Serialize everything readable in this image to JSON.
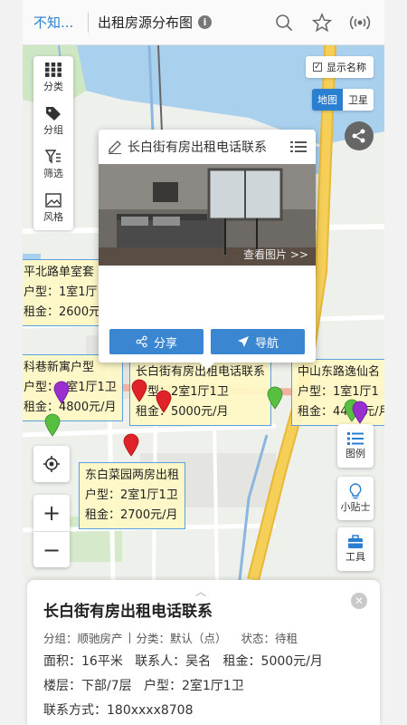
{
  "topbar": {
    "back": "不知...",
    "title": "出租房源分布图"
  },
  "map_controls": {
    "tools": [
      "分类",
      "分组",
      "筛选",
      "风格"
    ],
    "show_names": "显示名称",
    "map_types": [
      "地图",
      "卫星"
    ]
  },
  "popup": {
    "title": "长白街有房出租电话联系",
    "view_photos": "查看图片 >>",
    "share": "分享",
    "navigate": "导航"
  },
  "labels": [
    {
      "title": "平北路单室套",
      "type": "户型：1室1厅1卫",
      "rent": "租金：2600元/月"
    },
    {
      "title": "科巷新寓户型",
      "type": "户型：2室1厅1卫",
      "rent": "租金：4800元/月"
    },
    {
      "title": "长白街有房出租电话联系",
      "type": "户型：2室1厅1卫",
      "rent": "租金：5000元/月"
    },
    {
      "title": "中山东路逸仙名",
      "type": "户型：1室1厅1",
      "rent": "租金：4400元/月"
    },
    {
      "title": "东白菜园两房出租",
      "type": "户型：2室1厅1卫",
      "rent": "租金：2700元/月"
    }
  ],
  "side_buttons": {
    "legend": "图例",
    "tips": "小贴士",
    "tools": "工具"
  },
  "zoom": {
    "in": "+",
    "out": "−"
  },
  "detail": {
    "title": "长白街有房出租电话联系",
    "group": "分组：顺驰房产",
    "category": "分类：默认（点）",
    "status": "状态：待租",
    "area": "面积：16平米",
    "contact": "联系人：吴名",
    "rent": "租金：5000元/月",
    "floor": "楼层：下部/7层",
    "type": "户型：2室1厅1卫",
    "phone": "联系方式：180xxxx8708"
  },
  "colors": {
    "accent": "#2b7fd0",
    "pin_red": "#e0232a",
    "pin_green": "#58c040",
    "pin_purple": "#9a2fd0",
    "road": "#f6cf58"
  }
}
